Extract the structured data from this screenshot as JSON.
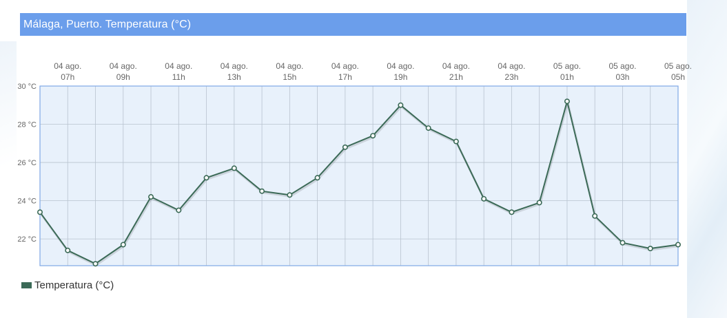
{
  "title": "Málaga, Puerto. Temperatura (°C)",
  "colors": {
    "title_bar": "#6b9eeb",
    "plot_background": "#e8f1fb",
    "plot_border": "#7fa8e6",
    "grid": "#b8c3cf",
    "series": "#3b6a57",
    "marker_fill": "#ffffff"
  },
  "chart_data": {
    "type": "line",
    "x_axis": {
      "position": "top",
      "tick_labels": [
        {
          "date": "04 ago.",
          "hour": "07h"
        },
        {
          "date": "04 ago.",
          "hour": "09h"
        },
        {
          "date": "04 ago.",
          "hour": "11h"
        },
        {
          "date": "04 ago.",
          "hour": "13h"
        },
        {
          "date": "04 ago.",
          "hour": "15h"
        },
        {
          "date": "04 ago.",
          "hour": "17h"
        },
        {
          "date": "04 ago.",
          "hour": "19h"
        },
        {
          "date": "04 ago.",
          "hour": "21h"
        },
        {
          "date": "04 ago.",
          "hour": "23h"
        },
        {
          "date": "05 ago.",
          "hour": "01h"
        },
        {
          "date": "05 ago.",
          "hour": "03h"
        },
        {
          "date": "05 ago.",
          "hour": "05h"
        }
      ]
    },
    "y_axis": {
      "ticks": [
        22,
        24,
        26,
        28,
        30
      ],
      "tick_labels": [
        "22 °C",
        "24 °C",
        "26 °C",
        "28 °C",
        "30 °C"
      ],
      "ylim": [
        20.6,
        30
      ]
    },
    "x": [
      "04 ago. 06h",
      "04 ago. 07h",
      "04 ago. 08h",
      "04 ago. 09h",
      "04 ago. 10h",
      "04 ago. 11h",
      "04 ago. 12h",
      "04 ago. 13h",
      "04 ago. 14h",
      "04 ago. 15h",
      "04 ago. 16h",
      "04 ago. 17h",
      "04 ago. 18h",
      "04 ago. 19h",
      "04 ago. 20h",
      "04 ago. 21h",
      "04 ago. 22h",
      "04 ago. 23h",
      "05 ago. 00h",
      "05 ago. 01h",
      "05 ago. 02h",
      "05 ago. 03h",
      "05 ago. 04h",
      "05 ago. 05h"
    ],
    "series": [
      {
        "name": "Temperatura (°C)",
        "values": [
          23.4,
          21.4,
          20.7,
          21.7,
          24.2,
          23.5,
          25.2,
          25.7,
          24.5,
          24.3,
          25.2,
          26.8,
          27.4,
          29.0,
          27.8,
          27.1,
          24.1,
          23.4,
          23.9,
          29.2,
          23.2,
          21.8,
          21.5,
          21.7
        ]
      }
    ],
    "grid": true,
    "legend": "bottom-left"
  }
}
